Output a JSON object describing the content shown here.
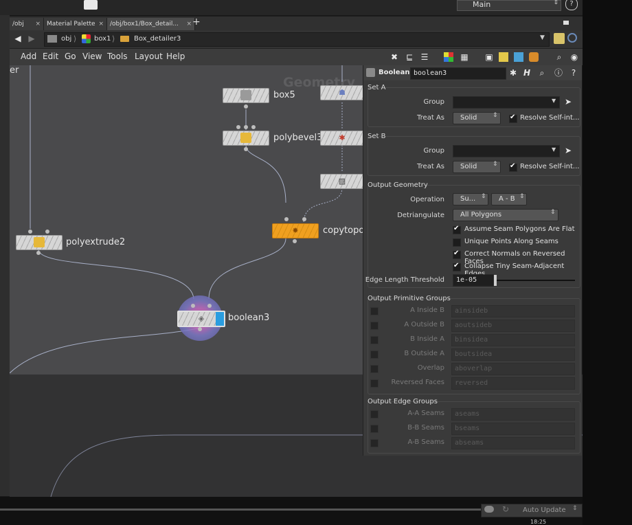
{
  "top": {
    "main_label": "Main",
    "help_glyph": "?"
  },
  "tabs": [
    {
      "label": "/obj",
      "close": "×"
    },
    {
      "label": "Material Palette",
      "close": "×"
    },
    {
      "label": "/obj/box1/Box_detail...",
      "close": "×"
    },
    {
      "label": "+"
    }
  ],
  "path": {
    "crumbs": [
      "obj",
      "box1",
      "Box_detailer3"
    ]
  },
  "menu": [
    "Add",
    "Edit",
    "Go",
    "View",
    "Tools",
    "Layout",
    "Help"
  ],
  "graph": {
    "left_edge_text": "er",
    "watermark": "Geometry",
    "nodes": {
      "box5": "box5",
      "polybevel3": "polybevel3",
      "polyextrude2": "polyextrude2",
      "copytopoints": "copytopo",
      "boolean3": "boolean3"
    }
  },
  "params": {
    "type": "Boolean",
    "name": "boolean3",
    "setA": {
      "title": "Set A",
      "group_label": "Group",
      "group_value": "",
      "treat_label": "Treat As",
      "treat_value": "Solid",
      "resolve_label": "Resolve Self-int...",
      "resolve_checked": true
    },
    "setB": {
      "title": "Set B",
      "group_label": "Group",
      "group_value": "",
      "treat_label": "Treat As",
      "treat_value": "Solid",
      "resolve_label": "Resolve Self-int...",
      "resolve_checked": true
    },
    "output": {
      "title": "Output Geometry",
      "operation_label": "Operation",
      "operation_value": "Su...",
      "operation_sub": "A - B",
      "detri_label": "Detriangulate",
      "detri_value": "All Polygons",
      "checks": [
        {
          "label": "Assume Seam Polygons Are Flat",
          "checked": true
        },
        {
          "label": "Unique Points Along Seams",
          "checked": false
        },
        {
          "label": "Correct Normals on Reversed Faces",
          "checked": true
        },
        {
          "label": "Collapse Tiny Seam-Adjacent Edges",
          "checked": true
        }
      ],
      "edge_label": "Edge Length Threshold",
      "edge_value": "1e-05"
    },
    "prim_groups": {
      "title": "Output Primitive Groups",
      "rows": [
        {
          "label": "A Inside B",
          "value": "ainsideb"
        },
        {
          "label": "A Outside B",
          "value": "aoutsideb"
        },
        {
          "label": "B Inside A",
          "value": "binsidea"
        },
        {
          "label": "B Outside A",
          "value": "boutsidea"
        },
        {
          "label": "Overlap",
          "value": "aboverlap"
        },
        {
          "label": "Reversed Faces",
          "value": "reversed"
        }
      ]
    },
    "edge_groups": {
      "title": "Output Edge Groups",
      "rows": [
        {
          "label": "A-A Seams",
          "value": "aseams"
        },
        {
          "label": "B-B Seams",
          "value": "bseams"
        },
        {
          "label": "A-B Seams",
          "value": "abseams"
        }
      ]
    }
  },
  "bottom": {
    "auto_update": "Auto Update",
    "time": "18:25"
  }
}
